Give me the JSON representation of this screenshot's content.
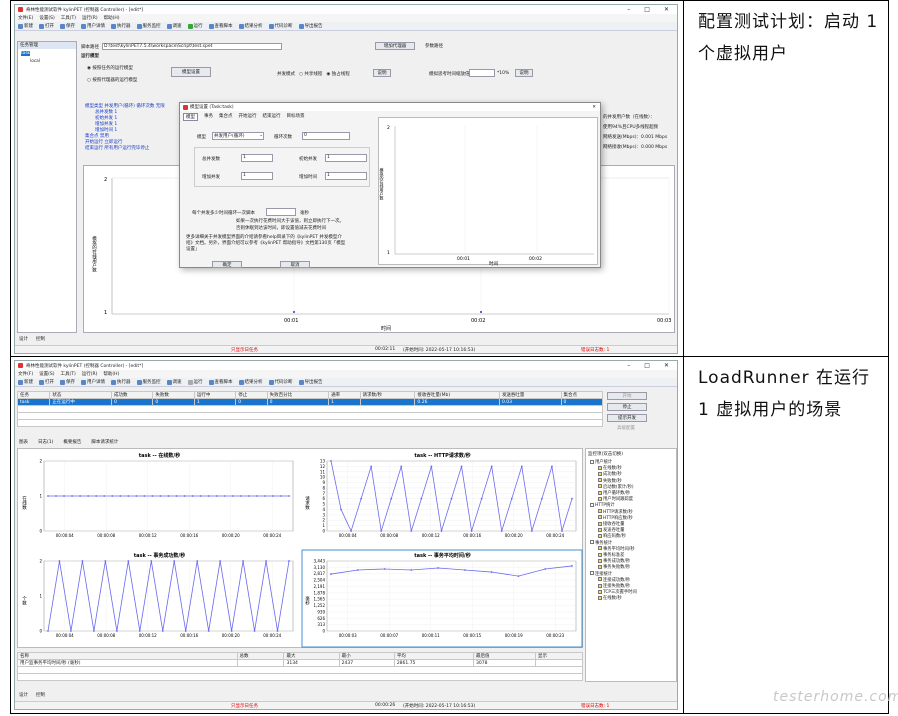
{
  "notes": [
    "配置测试计划：启动 1 个虚拟用户",
    "LoadRunner 在运行 1 虚拟用户的场景"
  ],
  "shot1": {
    "title": "奇林性能测试软件 kylinPET (控制器 Controller) - [edit*]",
    "menu": [
      "文件(E)",
      "设置(S)",
      "工具(T)",
      "运行(R)",
      "帮助(H)"
    ],
    "toolbar": [
      "新建",
      "打开",
      "保存",
      "用户详情",
      "执行器",
      "服务监控",
      "调速",
      "运行",
      "查看脚本",
      "结果分析",
      "代码诊断",
      "导出报告"
    ],
    "left_panel": {
      "title": "任务管理",
      "root": "task",
      "child": "local"
    },
    "script_path_label": "脚本路径",
    "script_path": "D:\\test\\kylinPET7.5.4\\workspace\\Script\\test.spet",
    "add_agent": "增加代理器",
    "param_path": "参数路径",
    "run_mode": "运行模型",
    "radio_task": "按照任务的运行模型",
    "radio_agent": "按照代理器的运行模型",
    "model_settings": "模型设置",
    "concurrency_mode": "并发模式",
    "shared_thread": "共享线程",
    "exclusive_thread": "独占线程",
    "explain": "说明",
    "think_time": "模拟思考时间缩放倍数",
    "think_unit": "*10%",
    "summary": [
      "模型类型  并发用户(循环)  循环次数  无限",
      "总并发数  1",
      "初始并发  1",
      "增加并发  1",
      "增加时间  1",
      "集合点  禁用",
      "开始运行  立即运行",
      "结束运行  所有用户运行完毕停止"
    ],
    "right_info": [
      "的并发用户数（在线数）：",
      "使用94%且CPU多线程超频",
      "网络发送(Mbps)：0.001 Mbps",
      "网络接收(Mbps)：0.000 Mbps"
    ],
    "dialog": {
      "title": "模型设置 (Task:task)",
      "tabs": [
        "模型",
        "事务",
        "集合点",
        "开始运行",
        "结束运行",
        "目标场景"
      ],
      "model_label": "模型",
      "model_value": "并发用户(循环)",
      "loop_label": "循环次数",
      "loop_value": "0",
      "total_label": "总并发数",
      "total_value": "1",
      "initial_label": "初始并发",
      "initial_value": "1",
      "add_label": "增加并发",
      "add_value": "1",
      "add_time_label": "增加时间",
      "add_time_value": "1",
      "loop_note": "每个并发多少时间循环一次脚本",
      "ms": "毫秒",
      "tip1": "如果一次执行花费时间大于该值，则立即执行下一次。",
      "tip2": "否则休眠到达该时间，即设置值减去花费时间",
      "help": "更多详细关于并发模型界面的介绍请参看help目录下的《kylinPET 并发模型介绍》文档。另外，界面介绍可以参考《kylinPET 帮助指导》文档第130页「模型设置」",
      "ok": "确定",
      "cancel": "取消",
      "ylabel": "模拟的在线用户数",
      "xlabel": "时间",
      "ticks": [
        "00:01",
        "00:02"
      ],
      "y_top": "2",
      "y_bot": "1"
    },
    "chart": {
      "ylabel": "模拟的在线用户数",
      "xlabel": "时间",
      "ticks": [
        "00:01",
        "00:02",
        "00:03"
      ],
      "y_top": "2",
      "y_bot": "1"
    },
    "bottom_tabs": [
      "设计",
      "控制"
    ],
    "status": {
      "msg": "只显示日任务",
      "time": "00:02:11",
      "save": "(开始时间: 2022-05-17 10:16:53)",
      "err": "错误日志数: 1"
    }
  },
  "shot2": {
    "title": "奇林性能测试软件 kylinPET (控制器 Controller) - [edit*]",
    "menu": [
      "文件(F)",
      "设置(S)",
      "工具(T)",
      "运行(R)",
      "帮助(H)"
    ],
    "toolbar": [
      "新建",
      "打开",
      "保存",
      "用户详情",
      "执行器",
      "服务监控",
      "调速",
      "运行",
      "查看脚本",
      "结果分析",
      "代码诊断",
      "导出报告"
    ],
    "table_headers": [
      "任务",
      "状态",
      "成功数",
      "失败数",
      "运行中",
      "停止",
      "失败百分比",
      "通率",
      "请求数/秒",
      "接收吞吐量(Mb)",
      "发送吞吐量",
      "集合点"
    ],
    "table_row": [
      "task",
      "正在运行中",
      "0",
      "0",
      "1",
      "0",
      "0",
      "1",
      "",
      "0.26",
      "0.03",
      "0"
    ],
    "side_buttons": [
      "开始",
      "停止",
      "提示开发",
      "高级配置"
    ],
    "tabs": [
      "图表",
      "日志(1)",
      "概要报告",
      "脚本请求统计"
    ],
    "charts": [
      {
        "type": "line",
        "title": "task -- 在线数/秒",
        "ylabel": "在线数",
        "yticks": [
          "2",
          "1",
          "0"
        ],
        "x": [
          "00:00:04",
          "00:00:08",
          "00:00:12",
          "00:00:16",
          "00:00:20",
          "00:00:24"
        ],
        "values": [
          1,
          1,
          1,
          1,
          1,
          1,
          1,
          1,
          1,
          1,
          1,
          1,
          1,
          1,
          1,
          1,
          1,
          1,
          1,
          1,
          1,
          1,
          1,
          1,
          1,
          1,
          1,
          1,
          1,
          1,
          1
        ]
      },
      {
        "type": "line",
        "title": "task -- HTTP请求数/秒",
        "ylabel": "请求数",
        "yticks": [
          "13",
          "12",
          "11",
          "10",
          "9",
          "8",
          "7",
          "6",
          "5",
          "4",
          "3",
          "2",
          "1",
          "0"
        ],
        "x": [
          "00:00:04",
          "00:00:08",
          "00:00:12",
          "00:00:16",
          "00:00:20",
          "00:00:24"
        ],
        "values": [
          13,
          4,
          0,
          6,
          12,
          0,
          6,
          12,
          0,
          6,
          12,
          0,
          6,
          12,
          0,
          6,
          12,
          0,
          6,
          12,
          0,
          6,
          12,
          0,
          6
        ]
      },
      {
        "type": "line",
        "title": "task -- 事务成功数/秒",
        "ylabel": "个数",
        "yticks": [
          "2",
          "1",
          "0"
        ],
        "x": [
          "00:00:04",
          "00:00:08",
          "00:00:12",
          "00:00:16",
          "00:00:20",
          "00:00:24"
        ],
        "values": [
          0,
          2,
          0,
          2,
          0,
          2,
          0,
          2,
          0,
          2,
          0,
          2,
          0,
          2,
          0,
          2,
          0,
          2,
          0,
          2,
          0,
          2
        ]
      },
      {
        "type": "line",
        "title": "task -- 事务平均时间/秒",
        "ylabel": "毫秒",
        "yticks": [
          "3,443",
          "3,130",
          "2,817",
          "2,504",
          "2,191",
          "1,878",
          "1,565",
          "1,252",
          "939",
          "626",
          "313",
          "0"
        ],
        "x": [
          "00:00:03",
          "00:00:07",
          "00:00:11",
          "00:00:15",
          "00:00:19",
          "00:00:23"
        ],
        "values": [
          2800,
          3000,
          3050,
          3000,
          3100,
          3000,
          2900,
          2700,
          3050,
          3200
        ]
      }
    ],
    "monitor_title": "监控项(双击切换)",
    "tree": [
      {
        "label": "用户统计",
        "level": 0
      },
      {
        "label": "在线数/秒",
        "level": 1
      },
      {
        "label": "成功数/秒",
        "level": 1
      },
      {
        "label": "失败数/秒",
        "level": 1
      },
      {
        "label": "启动数(累计/秒)",
        "level": 1
      },
      {
        "label": "用户循环数/秒",
        "level": 1
      },
      {
        "label": "用户时间跟踪度",
        "level": 1
      },
      {
        "label": "HTTP统计",
        "level": 0
      },
      {
        "label": "HTTP请求数/秒",
        "level": 1
      },
      {
        "label": "HTTP响应数/秒",
        "level": 1
      },
      {
        "label": "接收吞吐量",
        "level": 1
      },
      {
        "label": "发送吞吐量",
        "level": 1
      },
      {
        "label": "响应码数/秒",
        "level": 1
      },
      {
        "label": "事务统计",
        "level": 0
      },
      {
        "label": "事务平均时间/秒",
        "level": 1
      },
      {
        "label": "事务标准差",
        "level": 1
      },
      {
        "label": "事务成功数/秒",
        "level": 1
      },
      {
        "label": "事务失败数/秒",
        "level": 1
      },
      {
        "label": "连接统计",
        "level": 0
      },
      {
        "label": "连接成功数/秒",
        "level": 1
      },
      {
        "label": "连接失败数/秒",
        "level": 1
      },
      {
        "label": "TCP三次握手时间",
        "level": 1
      },
      {
        "label": "在线数/秒",
        "level": 1
      }
    ],
    "bottom_table": {
      "headers": [
        "名称",
        "总数",
        "最大",
        "最小",
        "平均",
        "最后值",
        "显示"
      ],
      "row": [
        "用户监事务平均时间/秒 (毫秒)",
        "",
        "3134",
        "2437",
        "2861.75",
        "3078",
        ""
      ]
    },
    "bottom_tabs": [
      "设计",
      "控制"
    ],
    "status": {
      "msg": "只显示日任务",
      "time": "00:00:26",
      "save": "(开始时间: 2022-05-17 10:16:53)",
      "err": "错误日志数: 1"
    }
  },
  "watermark": "testerhome.com",
  "colors": {
    "series": "#6b6bf0",
    "accent": "#1874cd",
    "error": "#dd0000"
  }
}
